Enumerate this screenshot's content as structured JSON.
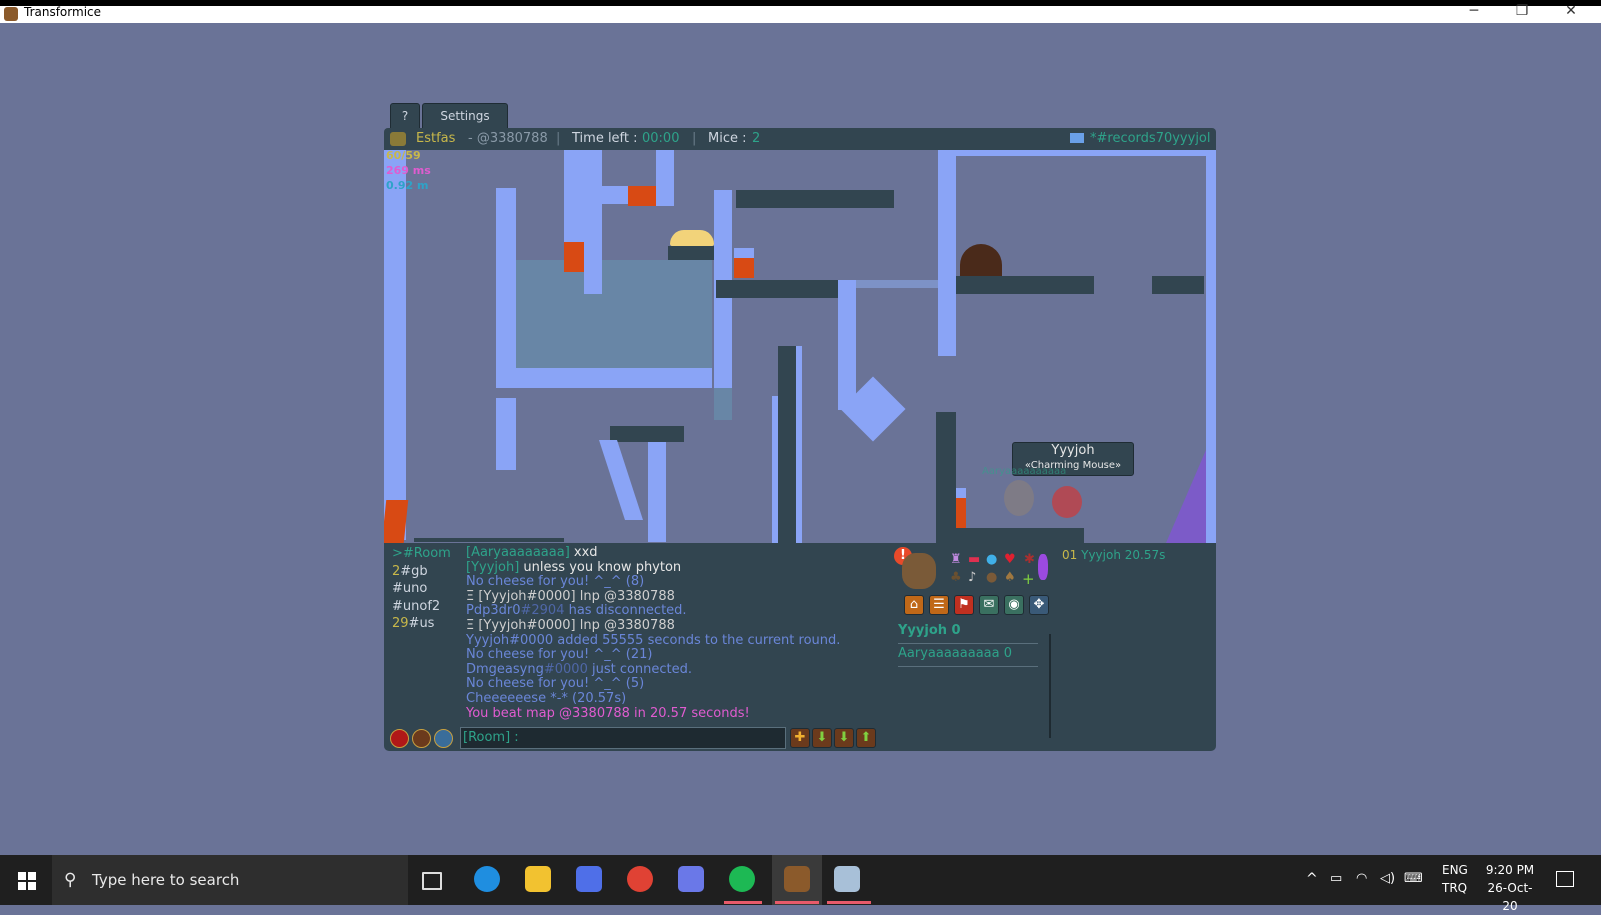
{
  "window": {
    "title": "Transformice",
    "minimize": "─",
    "restore": "❐",
    "close": "✕"
  },
  "tabs": {
    "help": "?",
    "settings": "Settings"
  },
  "header": {
    "player": "Estfas",
    "map_code": "- @3380788",
    "sep1": "|",
    "time_label": "Time left :",
    "time_value": "00:00",
    "sep2": "|",
    "mice_label": "Mice :",
    "mice_value": "2",
    "room": "*#records70yyyjol"
  },
  "stats": {
    "fps": "60/59",
    "ms": "269 ms",
    "mem": "0.92 m"
  },
  "mouse_tag": {
    "name": "Yyyjoh",
    "title": "«Charming Mouse»",
    "other": "Aaryaaaaaaaaaa"
  },
  "channels": [
    {
      "count": "",
      "name": ">#Room"
    },
    {
      "count": "2",
      "name": "#gb"
    },
    {
      "count": "",
      "name": "#uno"
    },
    {
      "count": "",
      "name": "#unof2"
    },
    {
      "count": "29",
      "name": "#us"
    }
  ],
  "chat": [
    {
      "parts": [
        {
          "t": "[Aaryaaaaaaaa] ",
          "c": "#2ea38a"
        },
        {
          "t": "xxd",
          "c": "#e6e6e6"
        }
      ]
    },
    {
      "parts": [
        {
          "t": "[Yyyjoh] ",
          "c": "#2ea38a"
        },
        {
          "t": "unless you know phyton",
          "c": "#e6e6e6"
        }
      ]
    },
    {
      "parts": [
        {
          "t": "No cheese for you! ^_^ (8)",
          "c": "#6a86d8"
        }
      ]
    },
    {
      "parts": [
        {
          "t": "Ξ [Yyyjoh#0000] lnp @3380788",
          "c": "#cfcfcf"
        }
      ]
    },
    {
      "parts": [
        {
          "t": "Pdp3dr0",
          "c": "#6a86d8"
        },
        {
          "t": "#2904",
          "c": "#4f67a8"
        },
        {
          "t": " has disconnected.",
          "c": "#6a86d8"
        }
      ]
    },
    {
      "parts": [
        {
          "t": "Ξ [Yyyjoh#0000] lnp @3380788",
          "c": "#cfcfcf"
        }
      ]
    },
    {
      "parts": [
        {
          "t": "Yyyjoh#0000 added 55555 seconds to the current round.",
          "c": "#6a86d8"
        }
      ]
    },
    {
      "parts": [
        {
          "t": "No cheese for you! ^_^ (21)",
          "c": "#6a86d8"
        }
      ]
    },
    {
      "parts": [
        {
          "t": "Dmgeasyng",
          "c": "#6a86d8"
        },
        {
          "t": "#0000",
          "c": "#4f67a8"
        },
        {
          "t": " just connected.",
          "c": "#6a86d8"
        }
      ]
    },
    {
      "parts": [
        {
          "t": "No cheese for you! ^_^ (5)",
          "c": "#6a86d8"
        }
      ]
    },
    {
      "parts": [
        {
          "t": "Cheeeeeese *-* (20.57s)",
          "c": "#6a86d8"
        }
      ]
    },
    {
      "parts": [
        {
          "t": "You beat map @3380788 in 20.57 seconds!",
          "c": "#e05cd0"
        }
      ]
    }
  ],
  "input": {
    "placeholder": "[Room] :"
  },
  "leaderboard": {
    "rank": "01",
    "name": "Yyyjoh",
    "time": "20.57s"
  },
  "players": [
    {
      "name": "Yyyjoh",
      "score": "0"
    },
    {
      "name": "Aaryaaaaaaaaa",
      "score": "0"
    }
  ],
  "taskbar": {
    "search_placeholder": "Type here to search",
    "lang1": "ENG",
    "lang2": "TRQ",
    "time": "9:20 PM",
    "date": "26-Oct-20"
  },
  "colors": {
    "accent_teal": "#2ea38a",
    "gold": "#c8b84a",
    "panel": "#324550",
    "map_bg": "#6a7397"
  }
}
